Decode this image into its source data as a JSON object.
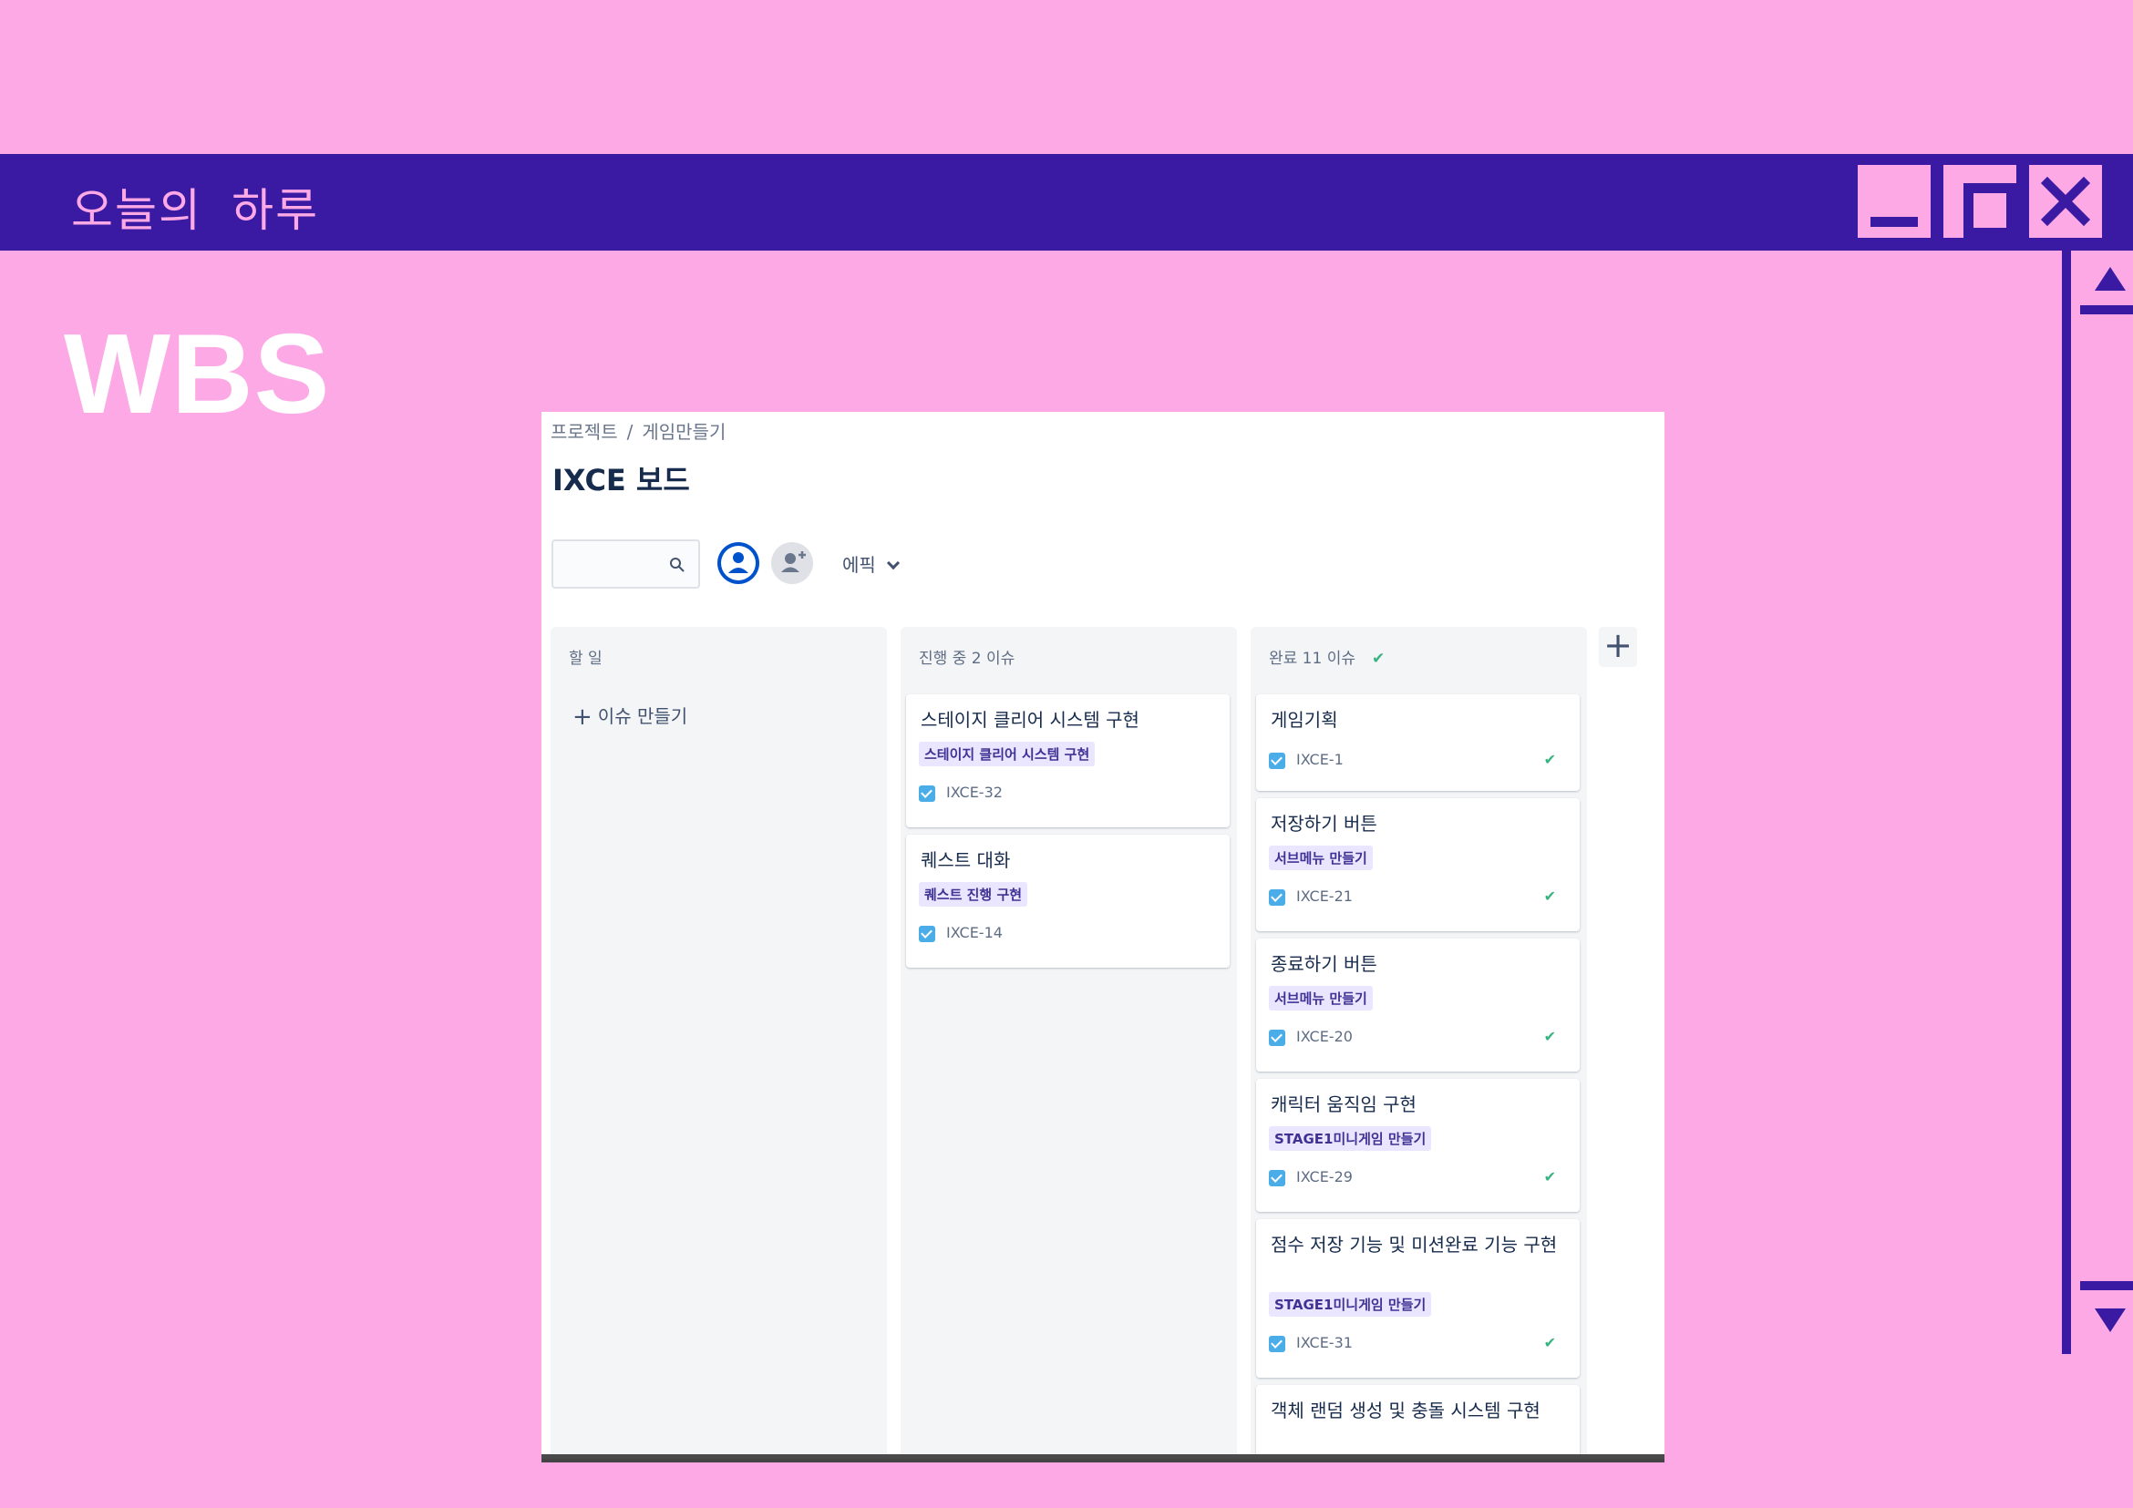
{
  "window": {
    "title": "오늘의 하루",
    "controls": {
      "minimize": "minimize",
      "maximize": "maximize",
      "close": "close"
    }
  },
  "slide": {
    "heading": "WBS"
  },
  "board": {
    "breadcrumb": [
      "프로젝트",
      "/",
      "게임만들기"
    ],
    "title": "IXCE 보드",
    "search": {
      "value": "",
      "placeholder": ""
    },
    "epic_filter": "에픽",
    "columns": [
      {
        "header": "할 일",
        "create_label": "이슈 만들기",
        "cards": []
      },
      {
        "header": "진행 중 2 이슈",
        "cards": [
          {
            "title": "스테이지 클리어 시스템 구현",
            "epic": "스테이지 클리어 시스템 구현",
            "key": "IXCE-32"
          },
          {
            "title": "퀘스트 대화",
            "epic": "퀘스트 진행 구현",
            "key": "IXCE-14"
          }
        ]
      },
      {
        "header": "완료 11 이슈",
        "done_mark": "✔",
        "cards": [
          {
            "title": "게임기획",
            "epic": "",
            "key": "IXCE-1",
            "done": "✔"
          },
          {
            "title": "저장하기 버튼",
            "epic": "서브메뉴 만들기",
            "key": "IXCE-21",
            "done": "✔"
          },
          {
            "title": "종료하기 버튼",
            "epic": "서브메뉴 만들기",
            "key": "IXCE-20",
            "done": "✔"
          },
          {
            "title": "캐릭터 움직임 구현",
            "epic": "STAGE1미니게임 만들기",
            "key": "IXCE-29",
            "done": "✔"
          },
          {
            "title": "점수 저장 기능 및 미션완료 기능 구현",
            "epic": "STAGE1미니게임 만들기",
            "key": "IXCE-31",
            "done": "✔"
          },
          {
            "title": "객체 랜덤 생성 및 충돌 시스템 구현",
            "epic": "",
            "key": "",
            "done": ""
          }
        ]
      }
    ],
    "add_column": "+"
  },
  "colors": {
    "background": "#FCA9E6",
    "titlebar": "#3A1AA2",
    "epic_tag_bg": "#EAE6FF",
    "done_check": "#36B37E"
  },
  "icons": [
    "minimize-icon",
    "maximize-icon",
    "close-icon",
    "scroll-up-icon",
    "scroll-down-icon",
    "search-icon",
    "user-avatar-icon",
    "add-user-icon",
    "chevron-down-icon",
    "plus-icon",
    "checkbox-icon",
    "check-icon"
  ]
}
